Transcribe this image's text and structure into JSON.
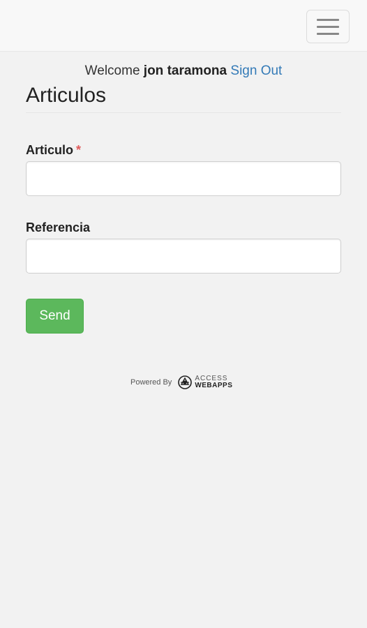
{
  "header": {
    "menu_icon": "hamburger-icon"
  },
  "welcome": {
    "prefix": "Welcome",
    "user_name": "jon taramona",
    "sign_out_label": "Sign Out"
  },
  "page": {
    "title": "Articulos"
  },
  "form": {
    "articulo": {
      "label": "Articulo",
      "required_marker": "*",
      "value": ""
    },
    "referencia": {
      "label": "Referencia",
      "value": ""
    },
    "send_label": "Send"
  },
  "footer": {
    "powered_by": "Powered By",
    "logo_line1": "ACCESS",
    "logo_line2": "WEBAPPS",
    "logo_icon": "access-webapps-logo-icon"
  },
  "colors": {
    "background": "#f2f2f2",
    "navbar": "#f8f8f8",
    "link": "#337ab7",
    "primary_button": "#5cb85c",
    "required": "#e05a5a"
  }
}
